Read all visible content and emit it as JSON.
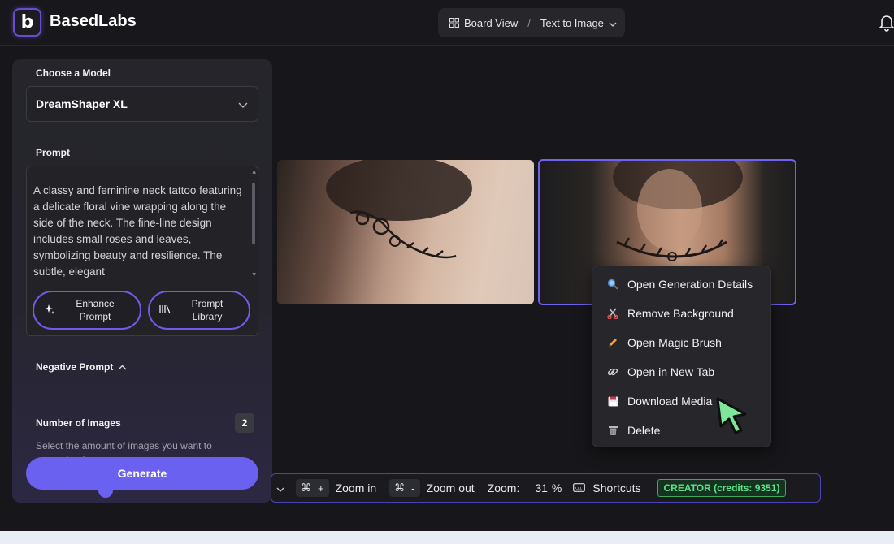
{
  "header": {
    "logo_letter": "b",
    "app_name": "BasedLabs",
    "view_label": "Board View",
    "separator": "/",
    "mode_label": "Text to Image"
  },
  "left_panel": {
    "choose_model_label": "Choose a Model",
    "model_value": "DreamShaper XL",
    "prompt_label": "Prompt",
    "prompt_text": "A classy and feminine neck tattoo featuring a delicate floral vine wrapping along the side of the neck. The fine-line design includes small roses and leaves, symbolizing beauty and resilience. The subtle, elegant",
    "enhance_label": "Enhance Prompt",
    "library_label": "Prompt Library",
    "negative_prompt_label": "Negative Prompt",
    "num_images_label": "Number of Images",
    "num_images_value": "2",
    "num_images_desc": "Select the amount of images you want to generate at once",
    "generate_label": "Generate"
  },
  "context_menu": {
    "items": [
      {
        "label": "Open Generation Details",
        "icon": "magnifier-icon"
      },
      {
        "label": "Remove Background",
        "icon": "scissors-icon"
      },
      {
        "label": "Open Magic Brush",
        "icon": "pencil-icon"
      },
      {
        "label": "Open in New Tab",
        "icon": "link-icon"
      },
      {
        "label": "Download Media",
        "icon": "floppy-disk-icon"
      },
      {
        "label": "Delete",
        "icon": "trash-icon"
      }
    ]
  },
  "toolbar": {
    "zoom_in_key": "⌘",
    "zoom_in_plus": "+",
    "zoom_in_label": "Zoom in",
    "zoom_out_key": "⌘",
    "zoom_out_minus": "-",
    "zoom_out_label": "Zoom out",
    "zoom_label": "Zoom:",
    "zoom_value": "31",
    "zoom_unit": "%",
    "shortcuts_label": "Shortcuts",
    "credits_label": "CREATOR (credits: 9351)"
  },
  "colors": {
    "accent": "#6b61f0",
    "credits_green": "#5ee08a",
    "background": "#17171b"
  }
}
